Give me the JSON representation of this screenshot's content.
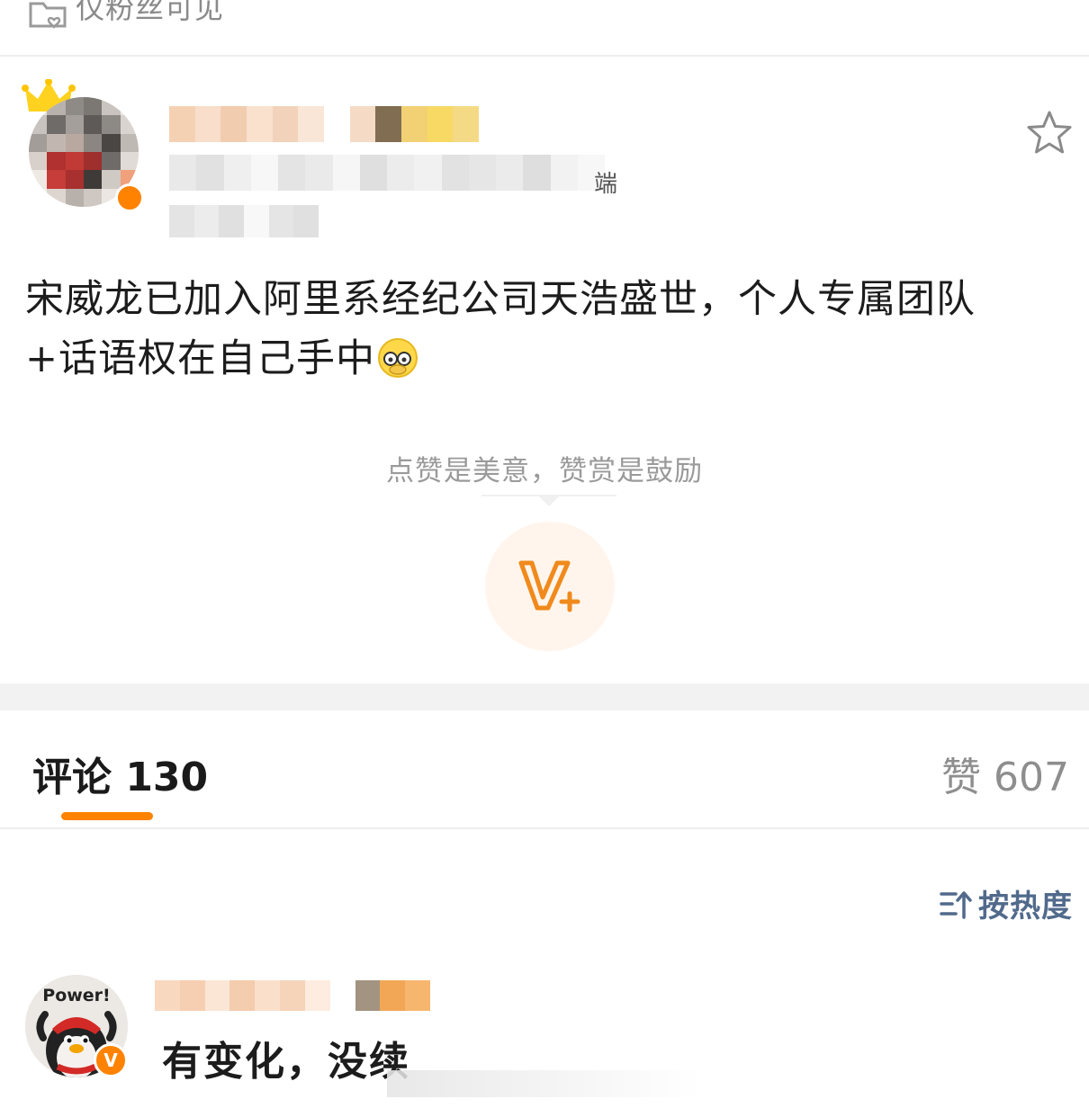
{
  "visibility": {
    "label": "仅粉丝可见",
    "icon": "lock-heart-icon"
  },
  "post": {
    "author": {
      "name": "",
      "crown_icon": "crown-icon",
      "badge_color": "#ff8200"
    },
    "meta_suffix": "端",
    "text_line1": "宋威龙已加入阿里系经纪公司天浩盛世，个人专属团队",
    "text_line2": "+话语权在自己手中",
    "emoji": "facepalm-emoji-icon",
    "favorite_icon": "star-outline-icon"
  },
  "reward": {
    "tip": "点赞是美意，赞赏是鼓励",
    "icon": "v-plus-icon"
  },
  "tabs": {
    "comments": "评论 130",
    "likes": "赞 607",
    "active_color": "#ff8200"
  },
  "sort": {
    "label": "按热度",
    "icon": "sort-icon"
  },
  "comments": [
    {
      "avatar_label": "Power!",
      "badge": "V",
      "text": "有变化，没续"
    }
  ]
}
